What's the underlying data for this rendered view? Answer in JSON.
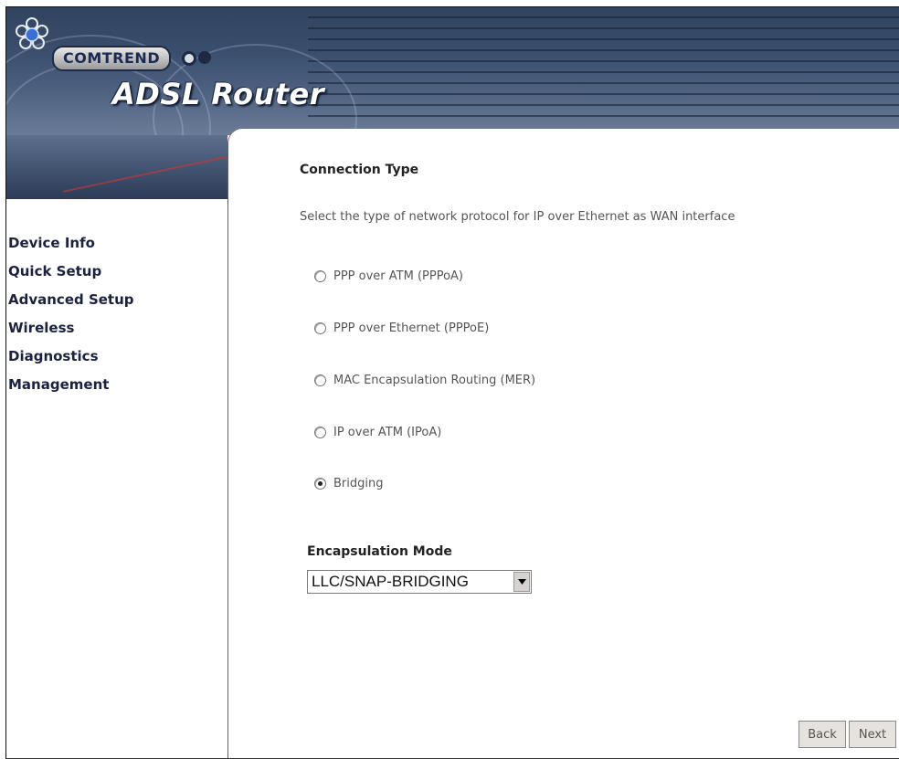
{
  "header": {
    "brand": "COMTREND",
    "product": "ADSL Router"
  },
  "sidebar": {
    "items": [
      {
        "label": "Device Info"
      },
      {
        "label": "Quick Setup"
      },
      {
        "label": "Advanced Setup"
      },
      {
        "label": "Wireless"
      },
      {
        "label": "Diagnostics"
      },
      {
        "label": "Management"
      }
    ]
  },
  "main": {
    "connection_type_title": "Connection Type",
    "description": "Select the type of network protocol for IP over Ethernet as WAN interface",
    "options": [
      {
        "label": "PPP over ATM (PPPoA)",
        "checked": false
      },
      {
        "label": "PPP over Ethernet (PPPoE)",
        "checked": false
      },
      {
        "label": "MAC Encapsulation Routing (MER)",
        "checked": false
      },
      {
        "label": "IP over ATM (IPoA)",
        "checked": false
      },
      {
        "label": "Bridging",
        "checked": true
      }
    ],
    "encapsulation_title": "Encapsulation Mode",
    "encapsulation_selected": "LLC/SNAP-BRIDGING",
    "back_label": "Back",
    "next_label": "Next"
  },
  "colors": {
    "banner": "#3a4e6d",
    "nav_text": "#1b2240",
    "content_border": "#9a4a4a"
  },
  "icons": {
    "logo": "comtrend-flower-logo",
    "dropdown": "chevron-down-icon"
  }
}
